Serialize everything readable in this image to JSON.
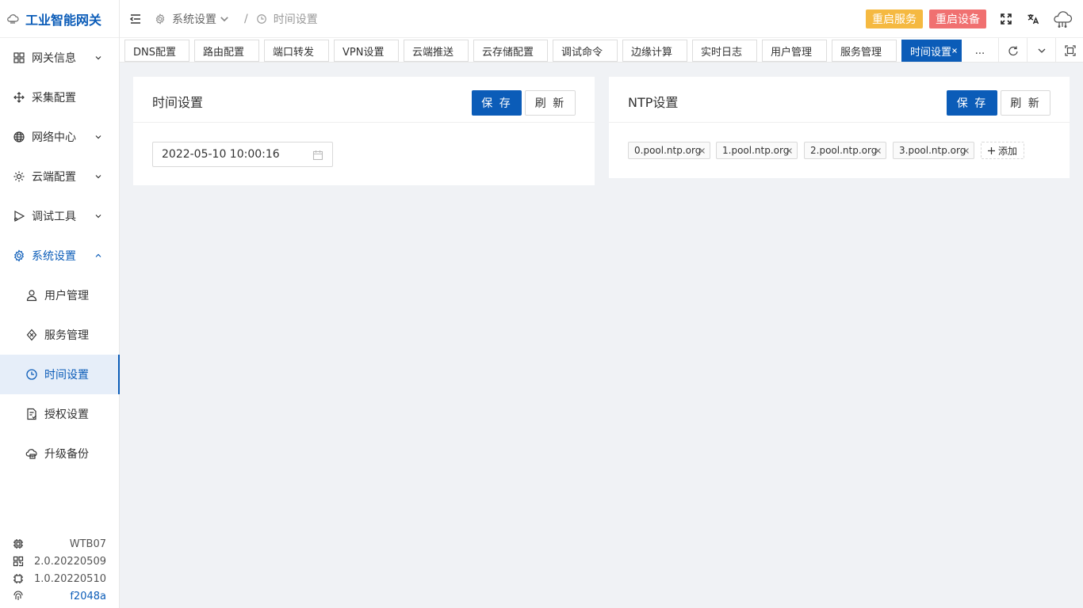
{
  "app": {
    "title": "工业智能网关"
  },
  "sidebar": {
    "items": [
      {
        "label": "网关信息",
        "icon": "grid-icon"
      },
      {
        "label": "采集配置",
        "icon": "move-icon"
      },
      {
        "label": "网络中心",
        "icon": "globe-icon"
      },
      {
        "label": "云端配置",
        "icon": "cloud-settings-icon"
      },
      {
        "label": "调试工具",
        "icon": "debug-icon"
      },
      {
        "label": "系统设置",
        "icon": "gear-icon"
      }
    ],
    "sub_items": [
      {
        "label": "用户管理",
        "icon": "user-icon"
      },
      {
        "label": "服务管理",
        "icon": "service-icon"
      },
      {
        "label": "时间设置",
        "icon": "clock-icon"
      },
      {
        "label": "授权设置",
        "icon": "license-icon"
      },
      {
        "label": "升级备份",
        "icon": "backup-icon"
      }
    ],
    "footer": {
      "model": "WTB07",
      "firmware_version": "2.0.20220509",
      "app_version": "1.0.20220510",
      "fingerprint": "f2048a"
    }
  },
  "header": {
    "breadcrumb": [
      "系统设置",
      "时间设置"
    ],
    "restart_service_label": "重启服务",
    "restart_device_label": "重启设备"
  },
  "tabs": {
    "items": [
      "DNS配置",
      "路由配置",
      "端口转发",
      "VPN设置",
      "云端推送",
      "云存储配置",
      "调试命令",
      "边缘计算",
      "实时日志",
      "用户管理",
      "服务管理",
      "时间设置"
    ],
    "active": "时间设置",
    "more_label": "..."
  },
  "time_card": {
    "title": "时间设置",
    "save_label": "保 存",
    "refresh_label": "刷 新",
    "datetime_value": "2022-05-10 10:00:16"
  },
  "ntp_card": {
    "title": "NTP设置",
    "save_label": "保 存",
    "refresh_label": "刷 新",
    "servers": [
      "0.pool.ntp.org",
      "1.pool.ntp.org",
      "2.pool.ntp.org",
      "3.pool.ntp.org"
    ],
    "add_label": "添加"
  },
  "colors": {
    "primary": "#0b5cb8",
    "warn": "#f5b941",
    "danger": "#f07070",
    "background": "#f0f2f5"
  }
}
